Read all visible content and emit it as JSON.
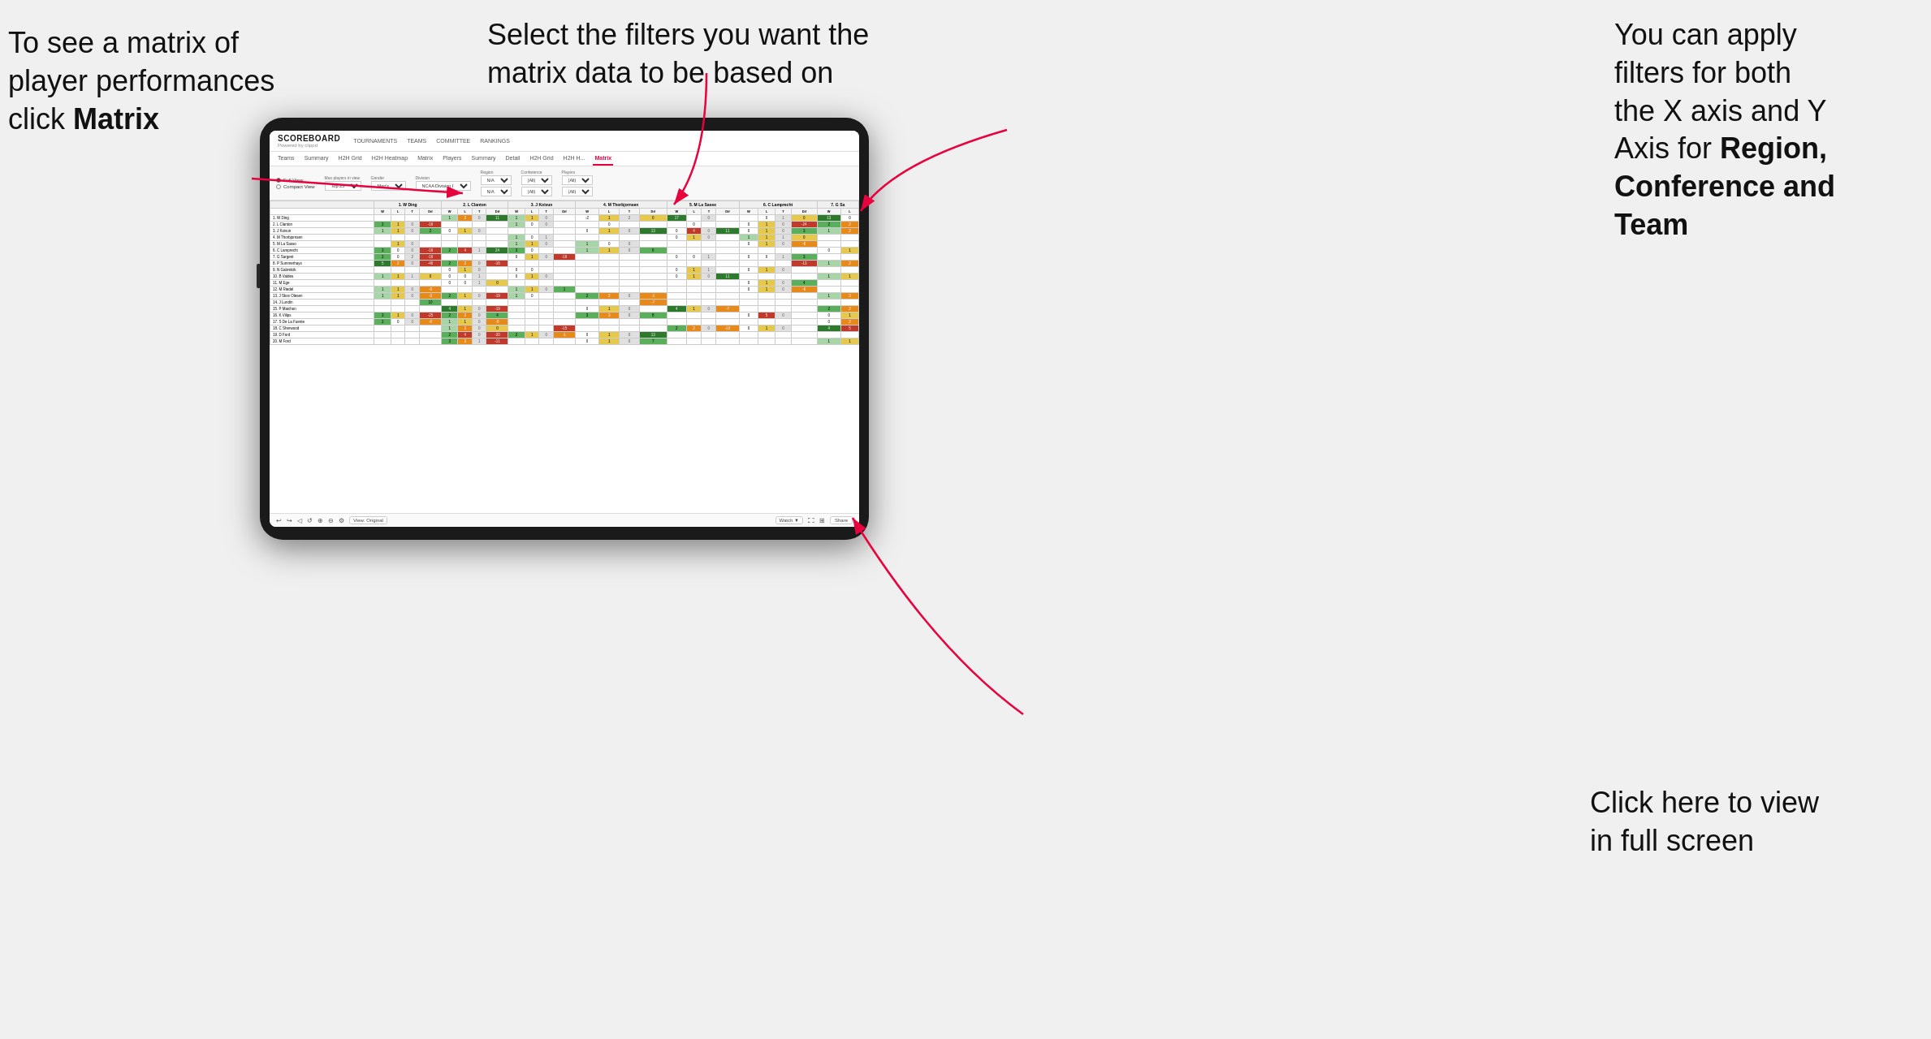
{
  "annotations": {
    "matrix_text": "To see a matrix of player performances click Matrix",
    "matrix_bold": "Matrix",
    "filters_text": "Select the filters you want the matrix data to be based on",
    "axes_text": "You  can apply filters for both the X axis and Y Axis for Region, Conference and Team",
    "axes_bold": "Region, Conference and Team",
    "fullscreen_text": "Click here to view in full screen"
  },
  "app": {
    "logo": "SCOREBOARD",
    "logo_sub": "Powered by clippd",
    "nav": [
      "TOURNAMENTS",
      "TEAMS",
      "COMMITTEE",
      "RANKINGS"
    ],
    "sub_tabs": [
      "Teams",
      "Summary",
      "H2H Grid",
      "H2H Heatmap",
      "Matrix",
      "Players",
      "Summary",
      "Detail",
      "H2H Grid",
      "H2H H...",
      "Matrix"
    ],
    "active_tab": "Matrix"
  },
  "filters": {
    "view_full": "Full View",
    "view_compact": "Compact View",
    "max_players_label": "Max players in view",
    "max_players_val": "Top 25",
    "gender_label": "Gender",
    "gender_val": "Men's",
    "division_label": "Division",
    "division_val": "NCAA Division I",
    "region_label": "Region",
    "region_val": "N/A",
    "conference_label": "Conference",
    "conference_val": "(All)",
    "players_label": "Players",
    "players_val": "(All)"
  },
  "players": [
    "1. W Ding",
    "2. L Clanton",
    "3. J Koivun",
    "4. M Thorbjornsen",
    "5. M La Sasso",
    "6. C Lamprecht",
    "7. G Sargent",
    "8. P Summerhays",
    "9. N Gabrelcik",
    "10. B Valdes",
    "11. M Ege",
    "12. M Riedel",
    "13. J Skov Olesen",
    "14. J Lundin",
    "15. P Maichon",
    "16. K Vilips",
    "17. S De La Fuente",
    "18. C Sherwood",
    "19. D Ford",
    "20. M Ford"
  ],
  "col_headers": [
    "1. W Ding",
    "2. L Clanton",
    "3. J Koivun",
    "4. M Thorbjornsen",
    "5. M La Sasso",
    "6. C Lamprecht",
    "7. G Sa"
  ],
  "toolbar": {
    "view_label": "View: Original",
    "watch_label": "Watch ▼",
    "share_label": "Share"
  }
}
